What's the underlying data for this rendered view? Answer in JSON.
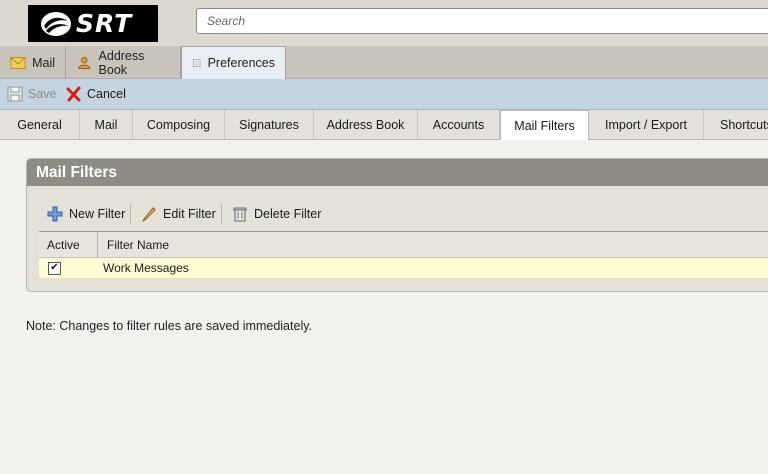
{
  "header": {
    "logo_text": "SRT",
    "search_placeholder": "Search"
  },
  "app_tabs": [
    {
      "label": "Mail",
      "icon": "mail-icon"
    },
    {
      "label": "Address Book",
      "icon": "contacts-icon"
    },
    {
      "label": "Preferences",
      "icon": "preferences-icon",
      "active": true
    }
  ],
  "toolbar": {
    "save_label": "Save",
    "cancel_label": "Cancel"
  },
  "pref_tabs": [
    {
      "label": "General"
    },
    {
      "label": "Mail"
    },
    {
      "label": "Composing"
    },
    {
      "label": "Signatures"
    },
    {
      "label": "Address Book"
    },
    {
      "label": "Accounts"
    },
    {
      "label": "Mail Filters",
      "active": true
    },
    {
      "label": "Import / Export"
    },
    {
      "label": "Shortcuts"
    }
  ],
  "filters_panel": {
    "title": "Mail Filters",
    "new_label": "New Filter",
    "edit_label": "Edit Filter",
    "delete_label": "Delete Filter",
    "columns": [
      "Active",
      "Filter Name"
    ],
    "rows": [
      {
        "active": true,
        "name": "Work Messages"
      }
    ]
  },
  "note": "Note: Changes to filter rules are saved immediately.",
  "colors": {
    "toolbar_bg": "#c5d4e1",
    "panel_title_bg": "#8f8c86",
    "selected_row_bg": "#fffbd3"
  }
}
